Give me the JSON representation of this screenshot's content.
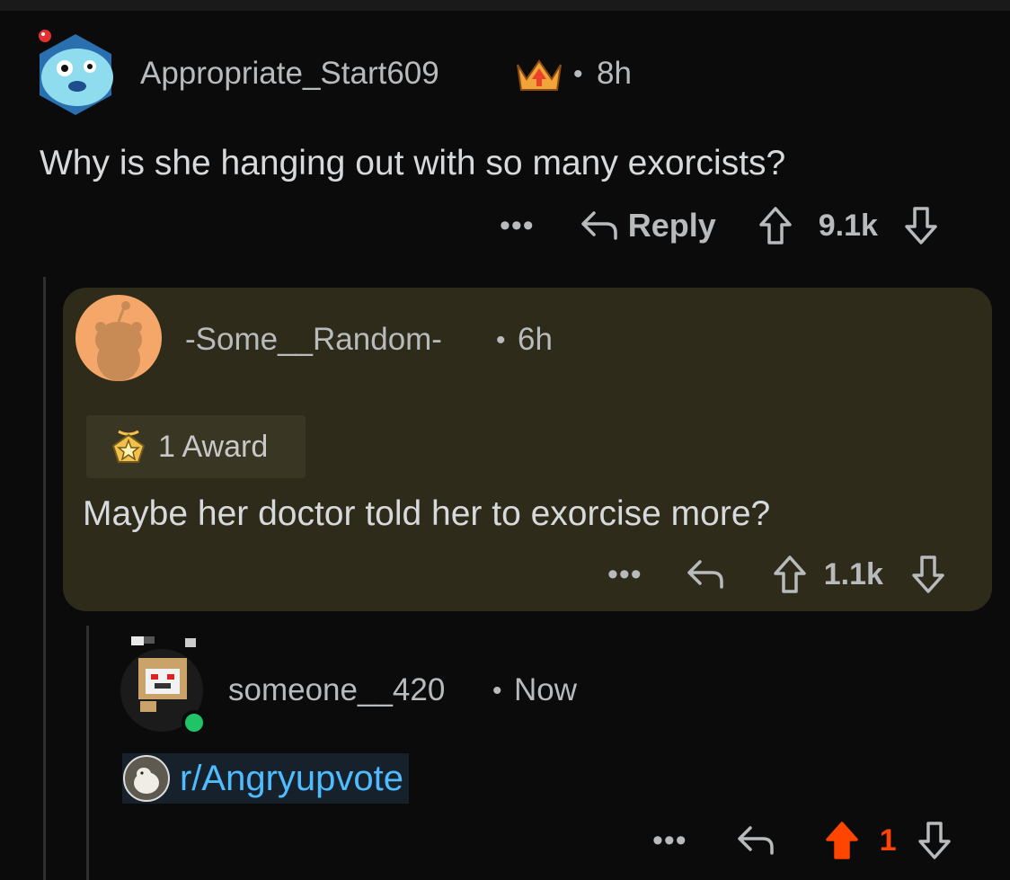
{
  "comments": [
    {
      "username": "Appropriate_Start609",
      "separator": "•",
      "time": "8h",
      "body": "Why is she hanging out with so many exorcists?",
      "more": "•••",
      "reply_label": "Reply",
      "votes": "9.1k"
    },
    {
      "username": "-Some__Random-",
      "separator": "•",
      "time": "6h",
      "award_label": "1 Award",
      "body": "Maybe her doctor told her to exorcise more?",
      "more": "•••",
      "votes": "1.1k"
    },
    {
      "username": "someone__420",
      "separator": "•",
      "time": "Now",
      "subreddit_link": "r/Angryupvote",
      "more": "•••",
      "votes": "1",
      "upvoted": true
    }
  ],
  "colors": {
    "background": "#0b0b0b",
    "highlight": "#2f2b1a",
    "upvote_active": "#ff4500",
    "link": "#4fbcff",
    "online": "#20c466"
  },
  "icons": [
    "reply-arrow-icon",
    "upvote-arrow-icon",
    "downvote-arrow-icon",
    "award-icon",
    "achievement-badge-icon"
  ]
}
